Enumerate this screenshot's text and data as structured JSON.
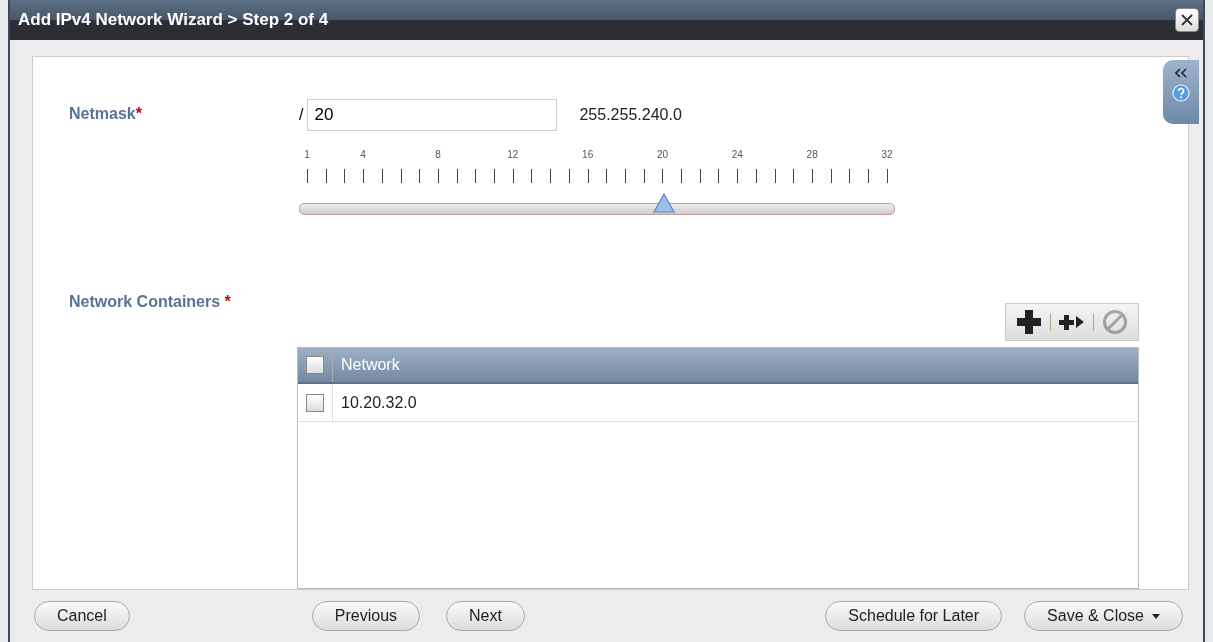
{
  "window": {
    "title": "Add IPv4 Network Wizard > Step 2 of 4"
  },
  "netmask": {
    "label": "Netmask",
    "required_mark": "*",
    "prefix": "/",
    "value": "20",
    "mask": "255.255.240.0",
    "scale_labels": [
      "1",
      "4",
      "8",
      "12",
      "16",
      "20",
      "24",
      "28",
      "32"
    ],
    "level": 0.613
  },
  "containers": {
    "label": "Network Containers",
    "required_mark": "*",
    "toolbar": [
      {
        "kind": "add",
        "disabled": false
      },
      {
        "kind": "add-next",
        "disabled": false
      },
      {
        "kind": "remove",
        "disabled": true
      }
    ],
    "columns": [
      {
        "label": "Network",
        "checked": false
      }
    ],
    "rows": [
      {
        "network": "10.20.32.0",
        "checked": false
      }
    ]
  },
  "buttons": [
    {
      "label": "Cancel",
      "kind": "plain"
    },
    {
      "label": "Previous",
      "kind": "plain"
    },
    {
      "label": "Next",
      "kind": "plain"
    },
    {
      "label": "Schedule for Later",
      "kind": "plain"
    },
    {
      "label": "Save & Close",
      "kind": "menu"
    }
  ]
}
